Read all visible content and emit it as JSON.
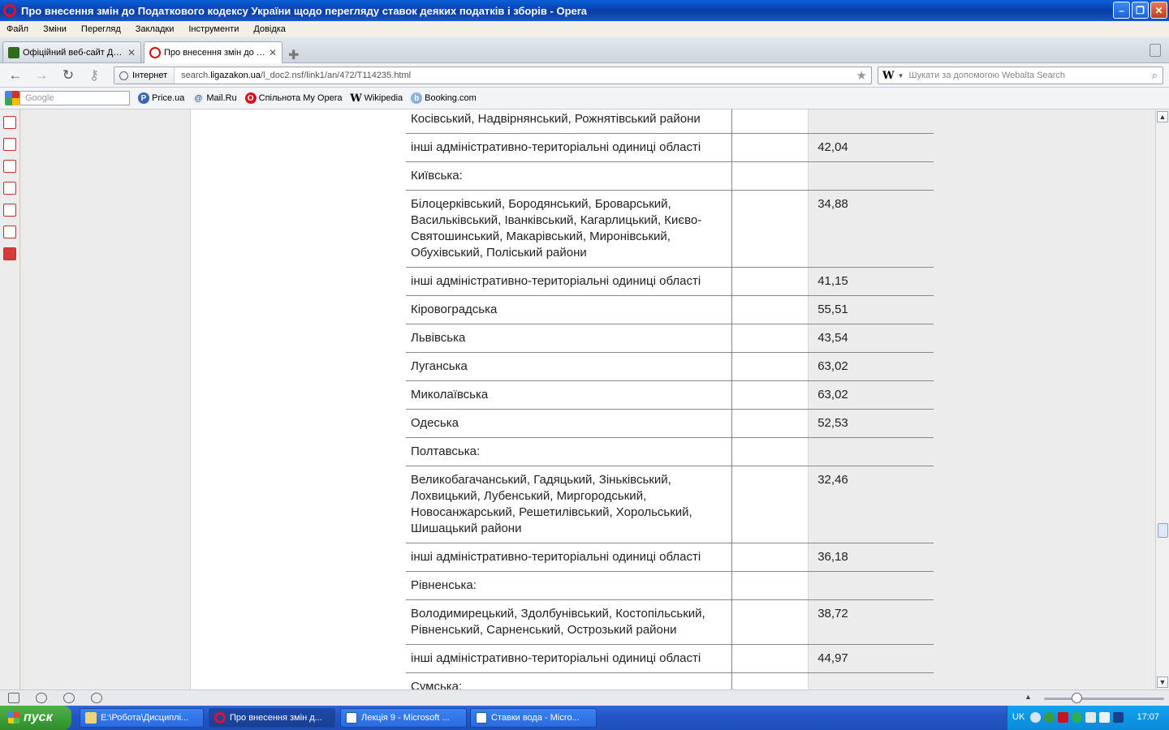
{
  "window": {
    "title": "Про внесення змін до Податкового кодексу України щодо перегляду ставок деяких податків і зборів - Opera"
  },
  "menu": [
    "Файл",
    "Зміни",
    "Перегляд",
    "Закладки",
    "Інструменти",
    "Довідка"
  ],
  "tabs": [
    {
      "label": "Офіційний веб-сайт Де..."
    },
    {
      "label": "Про внесення змін до П..."
    }
  ],
  "address": {
    "security_label": "Інтернет",
    "url_prefix": "search.",
    "url_domain": "ligazakon.ua",
    "url_path": "/l_doc2.nsf/link1/an/472/T114235.html"
  },
  "search": {
    "engine_letter": "W",
    "placeholder": "Шукати за допомогою Webalta Search"
  },
  "bookmarks": {
    "google_placeholder": "Google",
    "items": [
      {
        "label": "Price.ua",
        "icon": "P"
      },
      {
        "label": "Mail.Ru",
        "icon": "@"
      },
      {
        "label": "Спільнота My Opera",
        "icon": "O"
      },
      {
        "label": "Wikipedia",
        "icon": "W"
      },
      {
        "label": "Booking.com",
        "icon": "b"
      }
    ]
  },
  "table": {
    "rows": [
      {
        "name": "Косівський, Надвірнянський, Рожнятівський райони",
        "value": ""
      },
      {
        "name": "інші адміністративно-територіальні одиниці області",
        "value": "42,04"
      },
      {
        "name": "Київська:",
        "value": ""
      },
      {
        "name": "Білоцерківський, Бородянський, Броварський, Васильківський, Іванківський, Кагарлицький, Києво-Святошинський, Макарівський, Миронівський, Обухівський, Поліський райони",
        "value": "34,88"
      },
      {
        "name": "інші адміністративно-територіальні одиниці області",
        "value": "41,15"
      },
      {
        "name": "Кіровоградська",
        "value": "55,51"
      },
      {
        "name": "Львівська",
        "value": "43,54"
      },
      {
        "name": "Луганська",
        "value": "63,02"
      },
      {
        "name": "Миколаївська",
        "value": "63,02"
      },
      {
        "name": "Одеська",
        "value": "52,53"
      },
      {
        "name": "Полтавська:",
        "value": ""
      },
      {
        "name": "Великобагачанський, Гадяцький, Зіньківський, Лохвицький, Лубенський, Миргородський, Новосанжарський, Решетилівський, Хорольський, Шишацький райони",
        "value": "32,46"
      },
      {
        "name": "інші адміністративно-територіальні одиниці області",
        "value": "36,18"
      },
      {
        "name": "Рівненська:",
        "value": ""
      },
      {
        "name": "Володимирецький, Здолбунівський, Костопільський, Рівненський, Сарненський, Острозький райони",
        "value": "38,72"
      },
      {
        "name": "інші адміністративно-територіальні одиниці області",
        "value": "44,97"
      },
      {
        "name": "Сумська:",
        "value": ""
      }
    ]
  },
  "taskbar": {
    "start_label": "пуск",
    "tasks": [
      {
        "label": "E:\\Робота\\Дисциплі..."
      },
      {
        "label": "Про внесення змін д..."
      },
      {
        "label": "Лекція 9 - Microsoft ..."
      },
      {
        "label": "Ставки вода - Micro..."
      }
    ],
    "lang": "UK",
    "clock": "17:07"
  }
}
